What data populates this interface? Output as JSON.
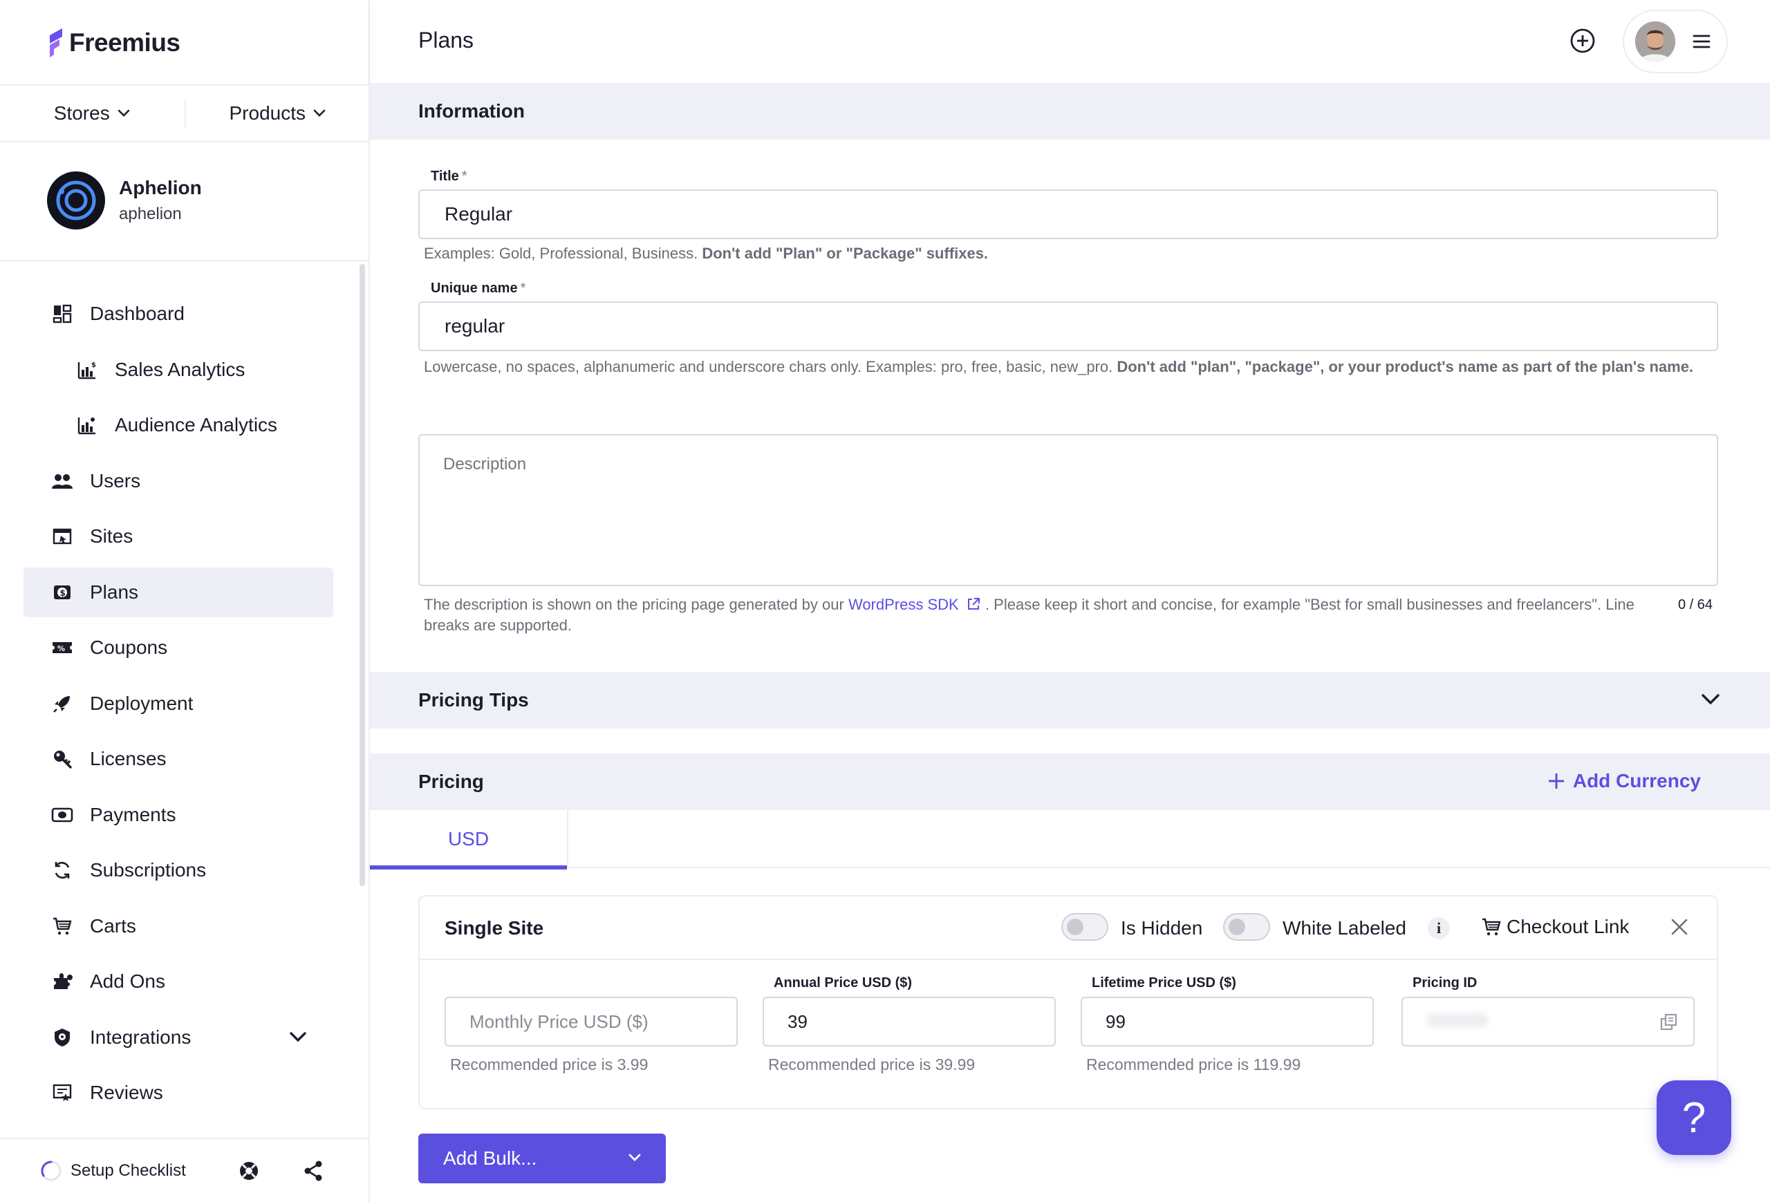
{
  "app": {
    "name": "Freemius",
    "brand_color": "#5b4fe0"
  },
  "sidebar": {
    "switchers": [
      {
        "label": "Stores"
      },
      {
        "label": "Products"
      }
    ],
    "store": {
      "name": "Aphelion",
      "slug": "aphelion"
    },
    "items": [
      {
        "label": "Dashboard",
        "icon": "dashboard-icon"
      },
      {
        "label": "Sales Analytics",
        "icon": "sales-analytics-icon"
      },
      {
        "label": "Audience Analytics",
        "icon": "audience-analytics-icon"
      },
      {
        "label": "Users",
        "icon": "users-icon"
      },
      {
        "label": "Sites",
        "icon": "sites-icon"
      },
      {
        "label": "Plans",
        "icon": "plans-icon",
        "active": true
      },
      {
        "label": "Coupons",
        "icon": "coupons-icon"
      },
      {
        "label": "Deployment",
        "icon": "deployment-icon"
      },
      {
        "label": "Licenses",
        "icon": "licenses-icon"
      },
      {
        "label": "Payments",
        "icon": "payments-icon"
      },
      {
        "label": "Subscriptions",
        "icon": "subscriptions-icon"
      },
      {
        "label": "Carts",
        "icon": "carts-icon"
      },
      {
        "label": "Add Ons",
        "icon": "add-ons-icon"
      },
      {
        "label": "Integrations",
        "icon": "integrations-icon"
      },
      {
        "label": "Reviews",
        "icon": "reviews-icon"
      }
    ],
    "footer": {
      "setup_checklist": "Setup Checklist"
    }
  },
  "header": {
    "title": "Plans"
  },
  "information": {
    "heading": "Information",
    "title_label": "Title",
    "required_mark": "*",
    "title_value": "Regular",
    "title_help": "Examples: Gold, Professional, Business.",
    "title_help_bold": "Don't add \"Plan\" or \"Package\" suffixes.",
    "unique_label": "Unique name",
    "unique_value": "regular",
    "unique_help": "Lowercase, no spaces, alphanumeric and underscore chars only. Examples: pro, free, basic, new_pro.",
    "unique_help_bold": "Don't add \"plan\", \"package\", or your product's name as part of the plan's name.",
    "description_placeholder": "Description",
    "description_help_pre": "The description is shown on the pricing page generated by our",
    "description_help_link": "WordPress SDK",
    "description_help_post": ". Please keep it short and concise, for example \"Best for small businesses and freelancers\". Line breaks are supported.",
    "description_counter": "0 / 64"
  },
  "pricing_tips": {
    "heading": "Pricing Tips"
  },
  "pricing": {
    "heading": "Pricing",
    "add_currency": "Add Currency",
    "tabs": [
      {
        "label": "USD"
      }
    ],
    "card": {
      "title": "Single Site",
      "is_hidden_label": "Is Hidden",
      "white_labeled_label": "White Labeled",
      "info_glyph": "i",
      "checkout_link": "Checkout Link",
      "monthly_placeholder": "Monthly Price USD ($)",
      "monthly_help": "Recommended price is 3.99",
      "annual_label": "Annual Price USD ($)",
      "annual_value": "39",
      "annual_help": "Recommended price is 39.99",
      "lifetime_label": "Lifetime Price USD ($)",
      "lifetime_value": "99",
      "lifetime_help": "Recommended price is 119.99",
      "pricing_id_label": "Pricing ID"
    },
    "add_bulk": "Add Bulk..."
  },
  "help_bubble_glyph": "?"
}
